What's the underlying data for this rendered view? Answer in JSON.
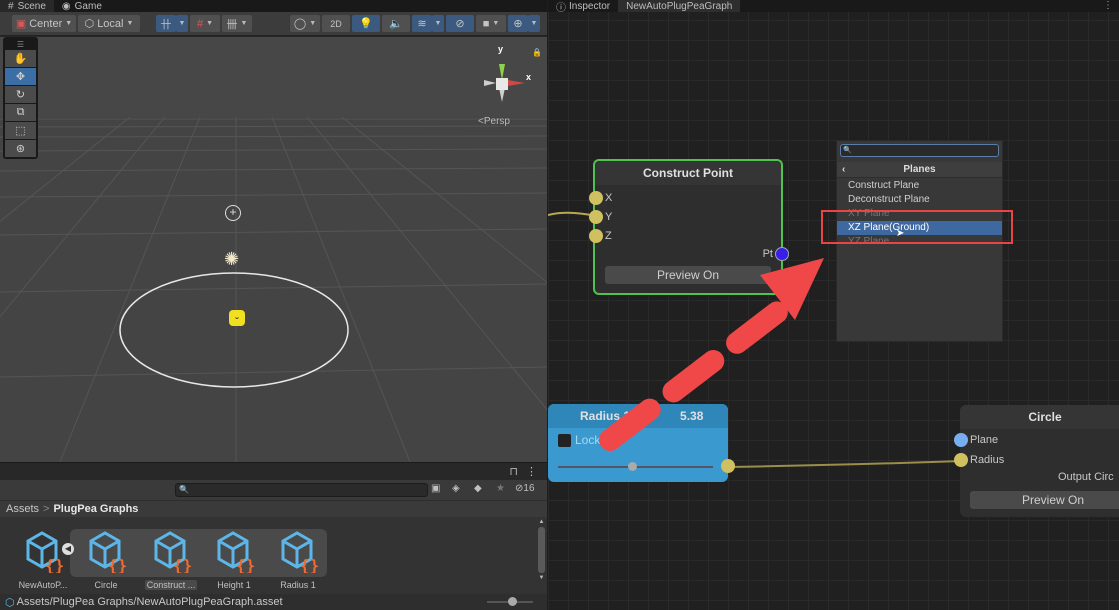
{
  "scene_panel": {
    "tabs": [
      {
        "label": "Scene",
        "icon": "grid-icon"
      },
      {
        "label": "Game",
        "icon": "gamepad-icon"
      }
    ],
    "toolbar": {
      "pivot_label": "Center",
      "space_label": "Local",
      "view_2d_label": "2D"
    },
    "tools": [
      "hand-tool",
      "move-tool",
      "rotate-tool",
      "scale-tool",
      "rect-tool",
      "transform-tool"
    ],
    "selected_tool": "move-tool",
    "gizmo": {
      "y_label": "y",
      "x_label": "x",
      "projection_label": "Persp"
    }
  },
  "project_panel": {
    "search_placeholder": "",
    "hidden_count": "16",
    "breadcrumb": {
      "root": "Assets",
      "separator": ">",
      "current": "PlugPea Graphs"
    },
    "assets": [
      {
        "label": "NewAutoP...",
        "selected": false
      },
      {
        "label": "Circle",
        "selected": false
      },
      {
        "label": "Construct ...",
        "selected": true
      },
      {
        "label": "Height 1",
        "selected": false
      },
      {
        "label": "Radius 1",
        "selected": false
      }
    ],
    "status_path": "Assets/PlugPea Graphs/NewAutoPlugPeaGraph.asset",
    "zoom_slider_fraction": 0.45
  },
  "graph_panel": {
    "tabs": [
      {
        "label": "Inspector",
        "icon": "info-icon"
      },
      {
        "label": "NewAutoPlugPeaGraph"
      }
    ],
    "construct_point": {
      "title": "Construct Point",
      "inputs": [
        "X",
        "Y",
        "Z"
      ],
      "output": "Pt",
      "preview_label": "Preview On"
    },
    "radius_node": {
      "title": "Radius 1",
      "value": "5.38",
      "lock_label": "Lock",
      "slider_fraction": 0.45
    },
    "circle_node": {
      "title": "Circle",
      "inputs": [
        "Plane",
        "Radius"
      ],
      "output": "Output Circ",
      "preview_label": "Preview On"
    },
    "search_menu": {
      "search_value": "",
      "header": "Planes",
      "items": [
        "Construct Plane",
        "Deconstruct Plane",
        "XY Plane",
        "XZ Plane(Ground)",
        "YZ Plane"
      ],
      "highlighted": "XZ Plane(Ground)"
    },
    "colors": {
      "highlight_box": "#e84545",
      "arrow": "#f04848",
      "node_selected_border": "#4fc24f",
      "radius_node_bg": "#3a9ad0"
    }
  }
}
